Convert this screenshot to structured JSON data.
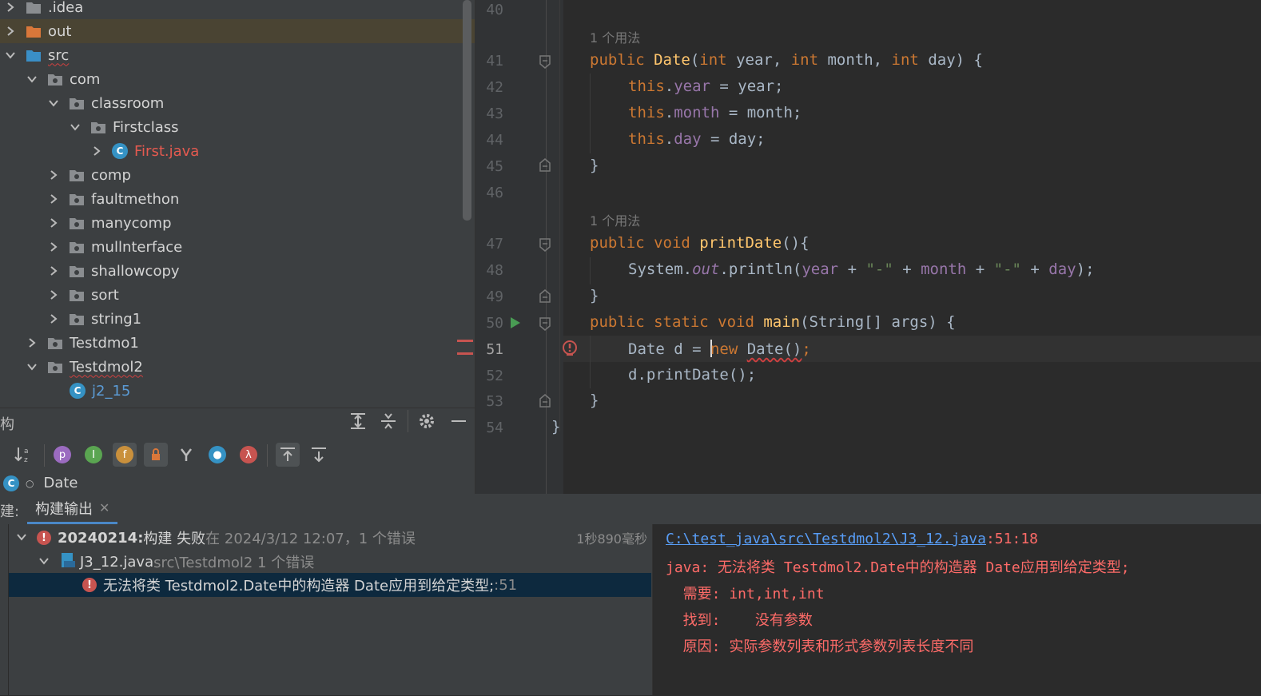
{
  "tree": {
    "items": [
      {
        "label": ".idea",
        "depth": 0,
        "expanded": false
      },
      {
        "label": "out",
        "depth": 0,
        "expanded": false
      },
      {
        "label": "src",
        "depth": 0,
        "expanded": true
      },
      {
        "label": "com",
        "depth": 1,
        "expanded": true
      },
      {
        "label": "classroom",
        "depth": 2,
        "expanded": true
      },
      {
        "label": "Firstclass",
        "depth": 3,
        "expanded": true
      },
      {
        "label": "First.java",
        "depth": 4,
        "expanded": false
      },
      {
        "label": "comp",
        "depth": 2,
        "expanded": false
      },
      {
        "label": "faultmethon",
        "depth": 2,
        "expanded": false
      },
      {
        "label": "manycomp",
        "depth": 2,
        "expanded": false
      },
      {
        "label": "mullnterface",
        "depth": 2,
        "expanded": false
      },
      {
        "label": "shallowcopy",
        "depth": 2,
        "expanded": false
      },
      {
        "label": "sort",
        "depth": 2,
        "expanded": false
      },
      {
        "label": "string1",
        "depth": 2,
        "expanded": false
      },
      {
        "label": "Testdmo1",
        "depth": 1,
        "expanded": false
      },
      {
        "label": "Testdmol2",
        "depth": 1,
        "expanded": true
      },
      {
        "label": "j2_15",
        "depth": 2,
        "expanded": false
      }
    ]
  },
  "structure": {
    "title": "构",
    "class_name": "Date",
    "tool_glyphs": {
      "p": "p",
      "i": "I",
      "f": "f",
      "lambda": "λ"
    }
  },
  "editor": {
    "lines": [
      {
        "n": "40"
      },
      {
        "hint": "1 个用法"
      },
      {
        "n": "41"
      },
      {
        "n": "42"
      },
      {
        "n": "43"
      },
      {
        "n": "44"
      },
      {
        "n": "45"
      },
      {
        "n": "46"
      },
      {
        "hint": "1 个用法"
      },
      {
        "n": "47"
      },
      {
        "n": "48"
      },
      {
        "n": "49"
      },
      {
        "n": "50"
      },
      {
        "n": "51"
      },
      {
        "n": "52"
      },
      {
        "n": "53"
      },
      {
        "n": "54"
      }
    ],
    "hint_usage": "1 个用法",
    "code": {
      "l41_a": "public ",
      "l41_b": "Date",
      "l41_c": "(",
      "l41_d": "int ",
      "l41_e": "year, ",
      "l41_f": "int ",
      "l41_g": "month, ",
      "l41_h": "int ",
      "l41_i": "day) {",
      "this_kw": "this",
      "year": "year",
      "month": "month",
      "day": "day",
      "l42_rest": " = year;",
      "l43_rest": " = month;",
      "l44_rest": " = day;",
      "close": "}",
      "l47_a": "public void ",
      "l47_b": "printDate",
      "l47_c": "(){",
      "l48_a": "System.",
      "l48_b": "out",
      "l48_c": ".println(",
      "dash": "\"-\"",
      "plus": " + ",
      "l48_end": ");",
      "l50_a": "public static void ",
      "l50_b": "main",
      "l50_c": "(String[] args) {",
      "l51_a": "Date d = ",
      "l51_b": "new ",
      "l51_c": "Date()",
      "l51_d": ";",
      "l52": "d.printDate();",
      "l54": "}"
    }
  },
  "build": {
    "tab_prefix": "建:",
    "tab_label": "构建输出",
    "root_label_bold": "20240214:",
    "root_label": " 构建 失败",
    "root_time": " 在 2024/3/12 12:07，1 个错误",
    "duration": "1秒890毫秒",
    "file_label": "J3_12.java",
    "file_path": " src\\Testdmol2 1 个错误",
    "error_label": "无法将类 Testdmol2.Date中的构造器 Date应用到给定类型; ",
    "error_line": ":51",
    "output": {
      "path_link": "C:\\test_java\\src\\Testdmol2\\J3_12.java",
      "path_pos": ":51:18",
      "line1": "java: 无法将类 Testdmol2.Date中的构造器 Date应用到给定类型;",
      "line2": "  需要: int,int,int",
      "line3": "  找到:    没有参数",
      "line4": "  原因: 实际参数列表和形式参数列表长度不同"
    }
  },
  "colors": {
    "accent": "#589df6",
    "error": "#c75450",
    "selection": "#0d293e"
  }
}
